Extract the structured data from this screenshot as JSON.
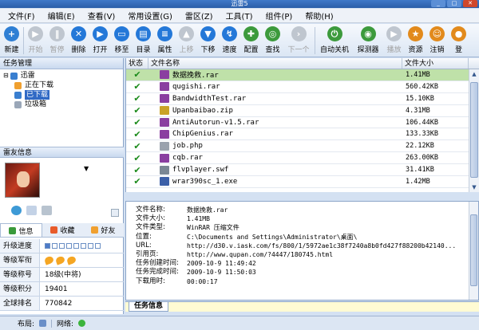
{
  "window": {
    "title": "迅雷5"
  },
  "menu": [
    "文件(F)",
    "编辑(E)",
    "查看(V)",
    "常用设置(G)",
    "雷区(Z)",
    "工具(T)",
    "组件(P)",
    "帮助(H)"
  ],
  "toolbar": [
    {
      "label": "新建",
      "icon": "new-icon",
      "color": "#2f7fd4",
      "glyph": "+",
      "disabled": false
    },
    {
      "label": "开始",
      "icon": "play-icon",
      "color": "#9aa3ad",
      "glyph": "▶",
      "disabled": true
    },
    {
      "label": "暂停",
      "icon": "pause-icon",
      "color": "#9aa3ad",
      "glyph": "‖",
      "disabled": true
    },
    {
      "label": "删除",
      "icon": "delete-icon",
      "color": "#2478d8",
      "glyph": "✕",
      "disabled": false
    },
    {
      "label": "打开",
      "icon": "open-icon",
      "color": "#2478d8",
      "glyph": "▶",
      "disabled": false
    },
    {
      "label": "移至",
      "icon": "move-icon",
      "color": "#2478d8",
      "glyph": "▭",
      "disabled": false
    },
    {
      "label": "目录",
      "icon": "folder-icon",
      "color": "#2478d8",
      "glyph": "▤",
      "disabled": false
    },
    {
      "label": "属性",
      "icon": "properties-icon",
      "color": "#2478d8",
      "glyph": "≡",
      "disabled": false
    },
    {
      "label": "上移",
      "icon": "move-up-icon",
      "color": "#9aa3ad",
      "glyph": "▲",
      "disabled": true
    },
    {
      "label": "下移",
      "icon": "move-down-icon",
      "color": "#2478d8",
      "glyph": "▼",
      "disabled": false
    },
    {
      "label": "速度",
      "icon": "speed-icon",
      "color": "#2478d8",
      "glyph": "↯",
      "disabled": false
    },
    {
      "label": "配置",
      "icon": "config-icon",
      "color": "#3c9a3c",
      "glyph": "✚",
      "disabled": false
    },
    {
      "label": "查找",
      "icon": "search-icon",
      "color": "#3c9a3c",
      "glyph": "◎",
      "disabled": false
    },
    {
      "label": "下一个",
      "icon": "next-icon",
      "color": "#9aa3ad",
      "glyph": "›",
      "disabled": true
    },
    {
      "label": "自动关机",
      "icon": "auto-shutdown-icon",
      "color": "#3c9a3c",
      "glyph": "⏻",
      "disabled": false
    },
    {
      "label": "探测器",
      "icon": "detector-icon",
      "color": "#3c9a3c",
      "glyph": "◉",
      "disabled": false
    },
    {
      "label": "播放",
      "icon": "video-play-icon",
      "color": "#9aa3ad",
      "glyph": "▶",
      "disabled": true
    },
    {
      "label": "资源",
      "icon": "resource-icon",
      "color": "#e28a1c",
      "glyph": "★",
      "disabled": false
    },
    {
      "label": "注销",
      "icon": "logout-icon",
      "color": "#e28a1c",
      "glyph": "☺",
      "disabled": false
    },
    {
      "label": "登",
      "icon": "login-icon",
      "color": "#e28a1c",
      "glyph": "●",
      "disabled": false
    }
  ],
  "task_panel": {
    "title": "任务管理",
    "root": "迅雷",
    "items": [
      {
        "label": "正在下载",
        "color": "#f0a030",
        "selected": false
      },
      {
        "label": "已下载",
        "color": "#3a7fd0",
        "selected": true
      },
      {
        "label": "垃圾箱",
        "color": "#9aa7b8",
        "selected": false
      }
    ]
  },
  "friend_panel": {
    "title": "雷友信息",
    "tabs": [
      {
        "label": "信息",
        "color": "#3a9a3a"
      },
      {
        "label": "收藏",
        "color": "#e85b2a"
      },
      {
        "label": "好友",
        "color": "#f0a030"
      }
    ],
    "rows": [
      {
        "key": "升级进度",
        "value": ""
      },
      {
        "key": "等级军衔",
        "value": ""
      },
      {
        "key": "等级称号",
        "value": "18级(中将)"
      },
      {
        "key": "等级积分",
        "value": "19401"
      },
      {
        "key": "全球排名",
        "value": "770842"
      }
    ],
    "progress": {
      "filled": 1,
      "total": 8
    }
  },
  "file_list": {
    "columns": [
      "状态",
      "文件名称",
      "文件大小"
    ],
    "rows": [
      {
        "name": "数据挽救.rar",
        "size": "1.41MB",
        "icon_color": "#8a3ea0"
      },
      {
        "name": "qugishi.rar",
        "size": "560.42KB",
        "icon_color": "#8a3ea0"
      },
      {
        "name": "BandwidthTest.rar",
        "size": "15.10KB",
        "icon_color": "#8a3ea0"
      },
      {
        "name": "Upanbaibao.zip",
        "size": "4.31MB",
        "icon_color": "#c9a227"
      },
      {
        "name": "AntiAutorun-v1.5.rar",
        "size": "106.44KB",
        "icon_color": "#8a3ea0"
      },
      {
        "name": "ChipGenius.rar",
        "size": "133.33KB",
        "icon_color": "#8a3ea0"
      },
      {
        "name": "job.php",
        "size": "22.12KB",
        "icon_color": "#9aa2ad"
      },
      {
        "name": "cqb.rar",
        "size": "263.00KB",
        "icon_color": "#8a3ea0"
      },
      {
        "name": "flvplayer.swf",
        "size": "31.41KB",
        "icon_color": "#7a8794"
      },
      {
        "name": "wrar390sc_1.exe",
        "size": "1.42MB",
        "icon_color": "#3b5fa8"
      }
    ]
  },
  "task_info": {
    "tab": "任务信息",
    "rows": [
      {
        "key": "文件名称:",
        "value": "数据挽救.rar"
      },
      {
        "key": "文件大小:",
        "value": "1.41MB"
      },
      {
        "key": "文件类型:",
        "value": "WinRAR 压缩文件"
      },
      {
        "key": "位置:",
        "value": "C:\\Documents and Settings\\Administrator\\桌面\\"
      },
      {
        "key": "URL:",
        "value": "http://d30.v.iask.com/fs/800/1/5972ae1c38f7240a8b0fd427f88200b42140..."
      },
      {
        "key": "引用页:",
        "value": "http://www.qupan.com/?4447/180745.html"
      },
      {
        "key": "任务创建时间:",
        "value": "2009-10-9 11:49:42"
      },
      {
        "key": "任务完成时间:",
        "value": "2009-10-9 11:50:03"
      },
      {
        "key": "下载用时:",
        "value": "00:00:17"
      }
    ]
  },
  "statusbar": {
    "layout_label": "布局:",
    "network_label": "网络:"
  }
}
